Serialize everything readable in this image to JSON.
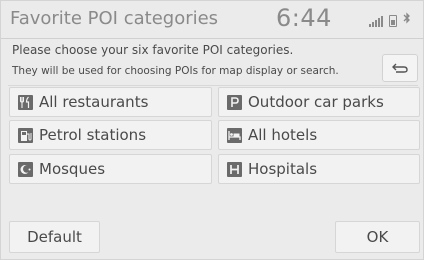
{
  "header": {
    "title": "Favorite POI categories",
    "clock": "6:44",
    "status_icons": [
      "signal-icon",
      "battery-icon",
      "bluetooth-icon"
    ]
  },
  "instructions": {
    "line1": "Please choose your six favorite POI categories.",
    "line2": "They will be used for choosing POIs for map display or search."
  },
  "back_button": {
    "icon": "back-arrow-icon"
  },
  "categories": [
    {
      "label": "All restaurants",
      "icon": "restaurant-icon"
    },
    {
      "label": "Outdoor car parks",
      "icon": "parking-icon"
    },
    {
      "label": "Petrol stations",
      "icon": "fuel-pump-icon"
    },
    {
      "label": "All hotels",
      "icon": "hotel-bed-icon"
    },
    {
      "label": "Mosques",
      "icon": "mosque-icon"
    },
    {
      "label": "Hospitals",
      "icon": "hospital-icon"
    }
  ],
  "footer": {
    "default_label": "Default",
    "ok_label": "OK"
  }
}
